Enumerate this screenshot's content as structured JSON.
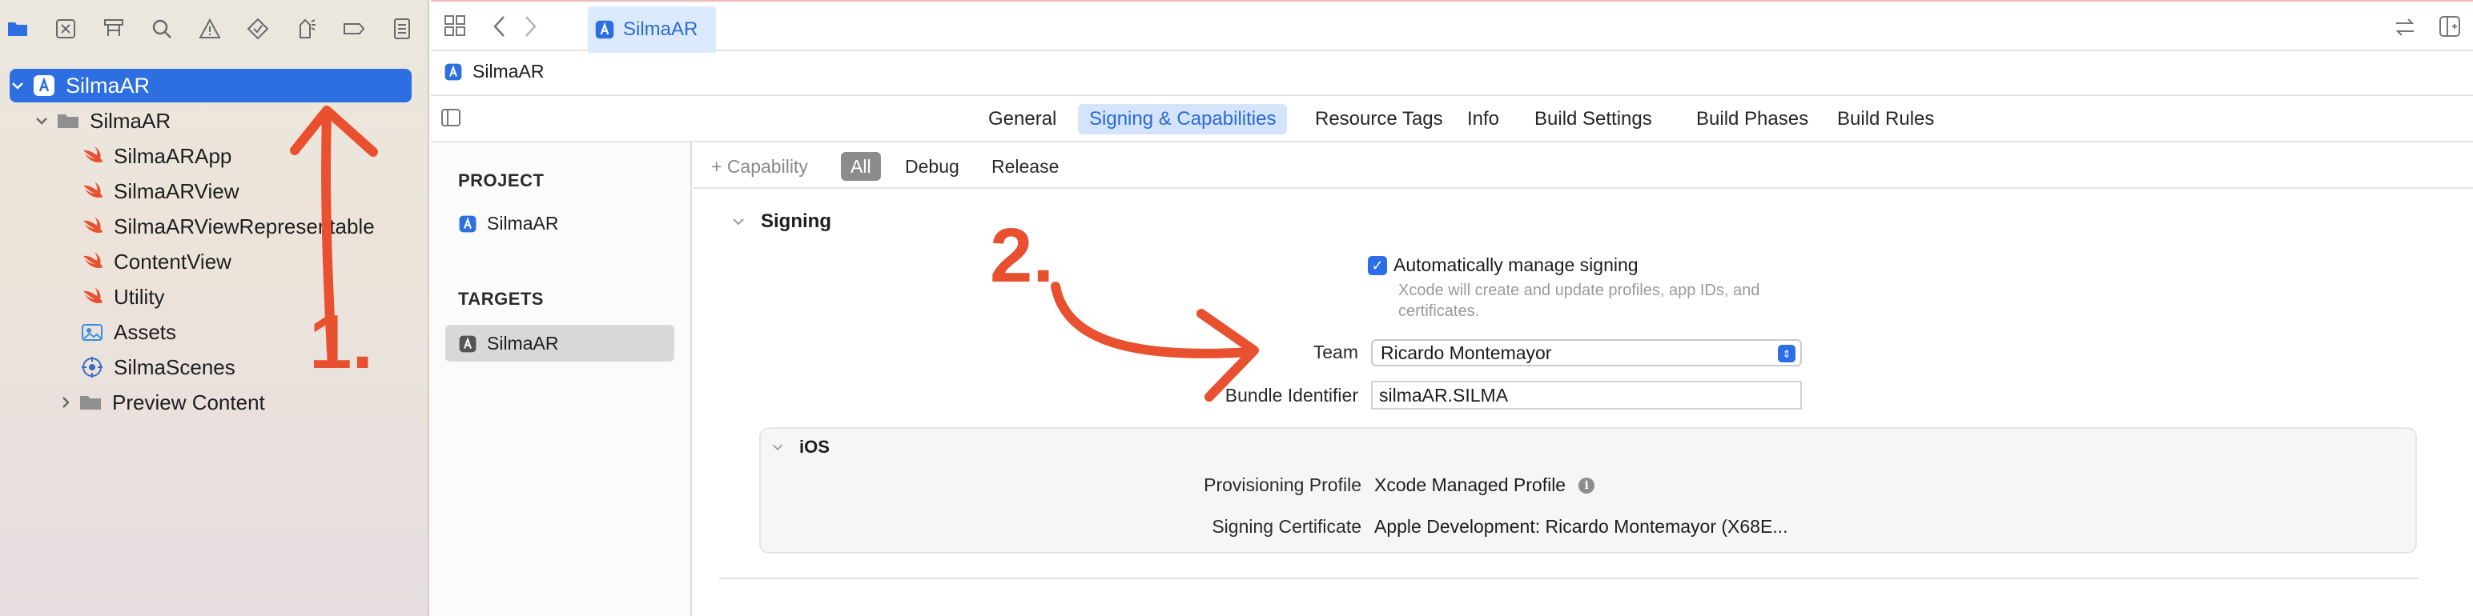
{
  "navigator": {
    "toolbar_icons": [
      "folder-icon",
      "source-control-icon",
      "hierarchy-icon",
      "search-icon",
      "warning-icon",
      "test-diamond-icon",
      "debug-icon",
      "breakpoint-icon",
      "report-icon"
    ],
    "items": [
      {
        "label": "SilmaAR",
        "type": "project",
        "selected": true,
        "expanded": true
      },
      {
        "label": "SilmaAR",
        "type": "folder",
        "expanded": true
      },
      {
        "label": "SilmaARApp",
        "type": "swift"
      },
      {
        "label": "SilmaARView",
        "type": "swift"
      },
      {
        "label": "SilmaARViewRepresentable",
        "type": "swift"
      },
      {
        "label": "ContentView",
        "type": "swift"
      },
      {
        "label": "Utility",
        "type": "swift"
      },
      {
        "label": "Assets",
        "type": "assets"
      },
      {
        "label": "SilmaScenes",
        "type": "scene"
      },
      {
        "label": "Preview Content",
        "type": "folder",
        "expanded": false
      }
    ]
  },
  "topbar": {
    "active_tab": "SilmaAR"
  },
  "breadcrumb": {
    "project": "SilmaAR"
  },
  "editor_tabs": [
    "General",
    "Signing & Capabilities",
    "Resource Tags",
    "Info",
    "Build Settings",
    "Build Phases",
    "Build Rules"
  ],
  "editor_tab_selected": "Signing & Capabilities",
  "project_list": {
    "project_header": "PROJECT",
    "project_item": "SilmaAR",
    "targets_header": "TARGETS",
    "target_item": "SilmaAR"
  },
  "capability_bar": {
    "add_capability": "+ Capability",
    "filters": [
      "All",
      "Debug",
      "Release"
    ],
    "selected": "All"
  },
  "signing": {
    "section_title": "Signing",
    "auto_manage_label": "Automatically manage signing",
    "auto_manage_checked": true,
    "auto_manage_desc_line1": "Xcode will create and update profiles, app IDs, and",
    "auto_manage_desc_line2": "certificates.",
    "team_label": "Team",
    "team_value": "Ricardo Montemayor",
    "bundle_label": "Bundle Identifier",
    "bundle_value": "silmaAR.SILMA"
  },
  "ios": {
    "title": "iOS",
    "provisioning_label": "Provisioning Profile",
    "provisioning_value": "Xcode Managed Profile",
    "certificate_label": "Signing Certificate",
    "certificate_value": "Apple Development: Ricardo Montemayor (X68E..."
  },
  "annotations": {
    "step1": "1.",
    "step2": "2.",
    "color": "#e8502f"
  },
  "colors": {
    "accent": "#2d6fe0",
    "selection_tab_bg": "#d4e4fb"
  }
}
